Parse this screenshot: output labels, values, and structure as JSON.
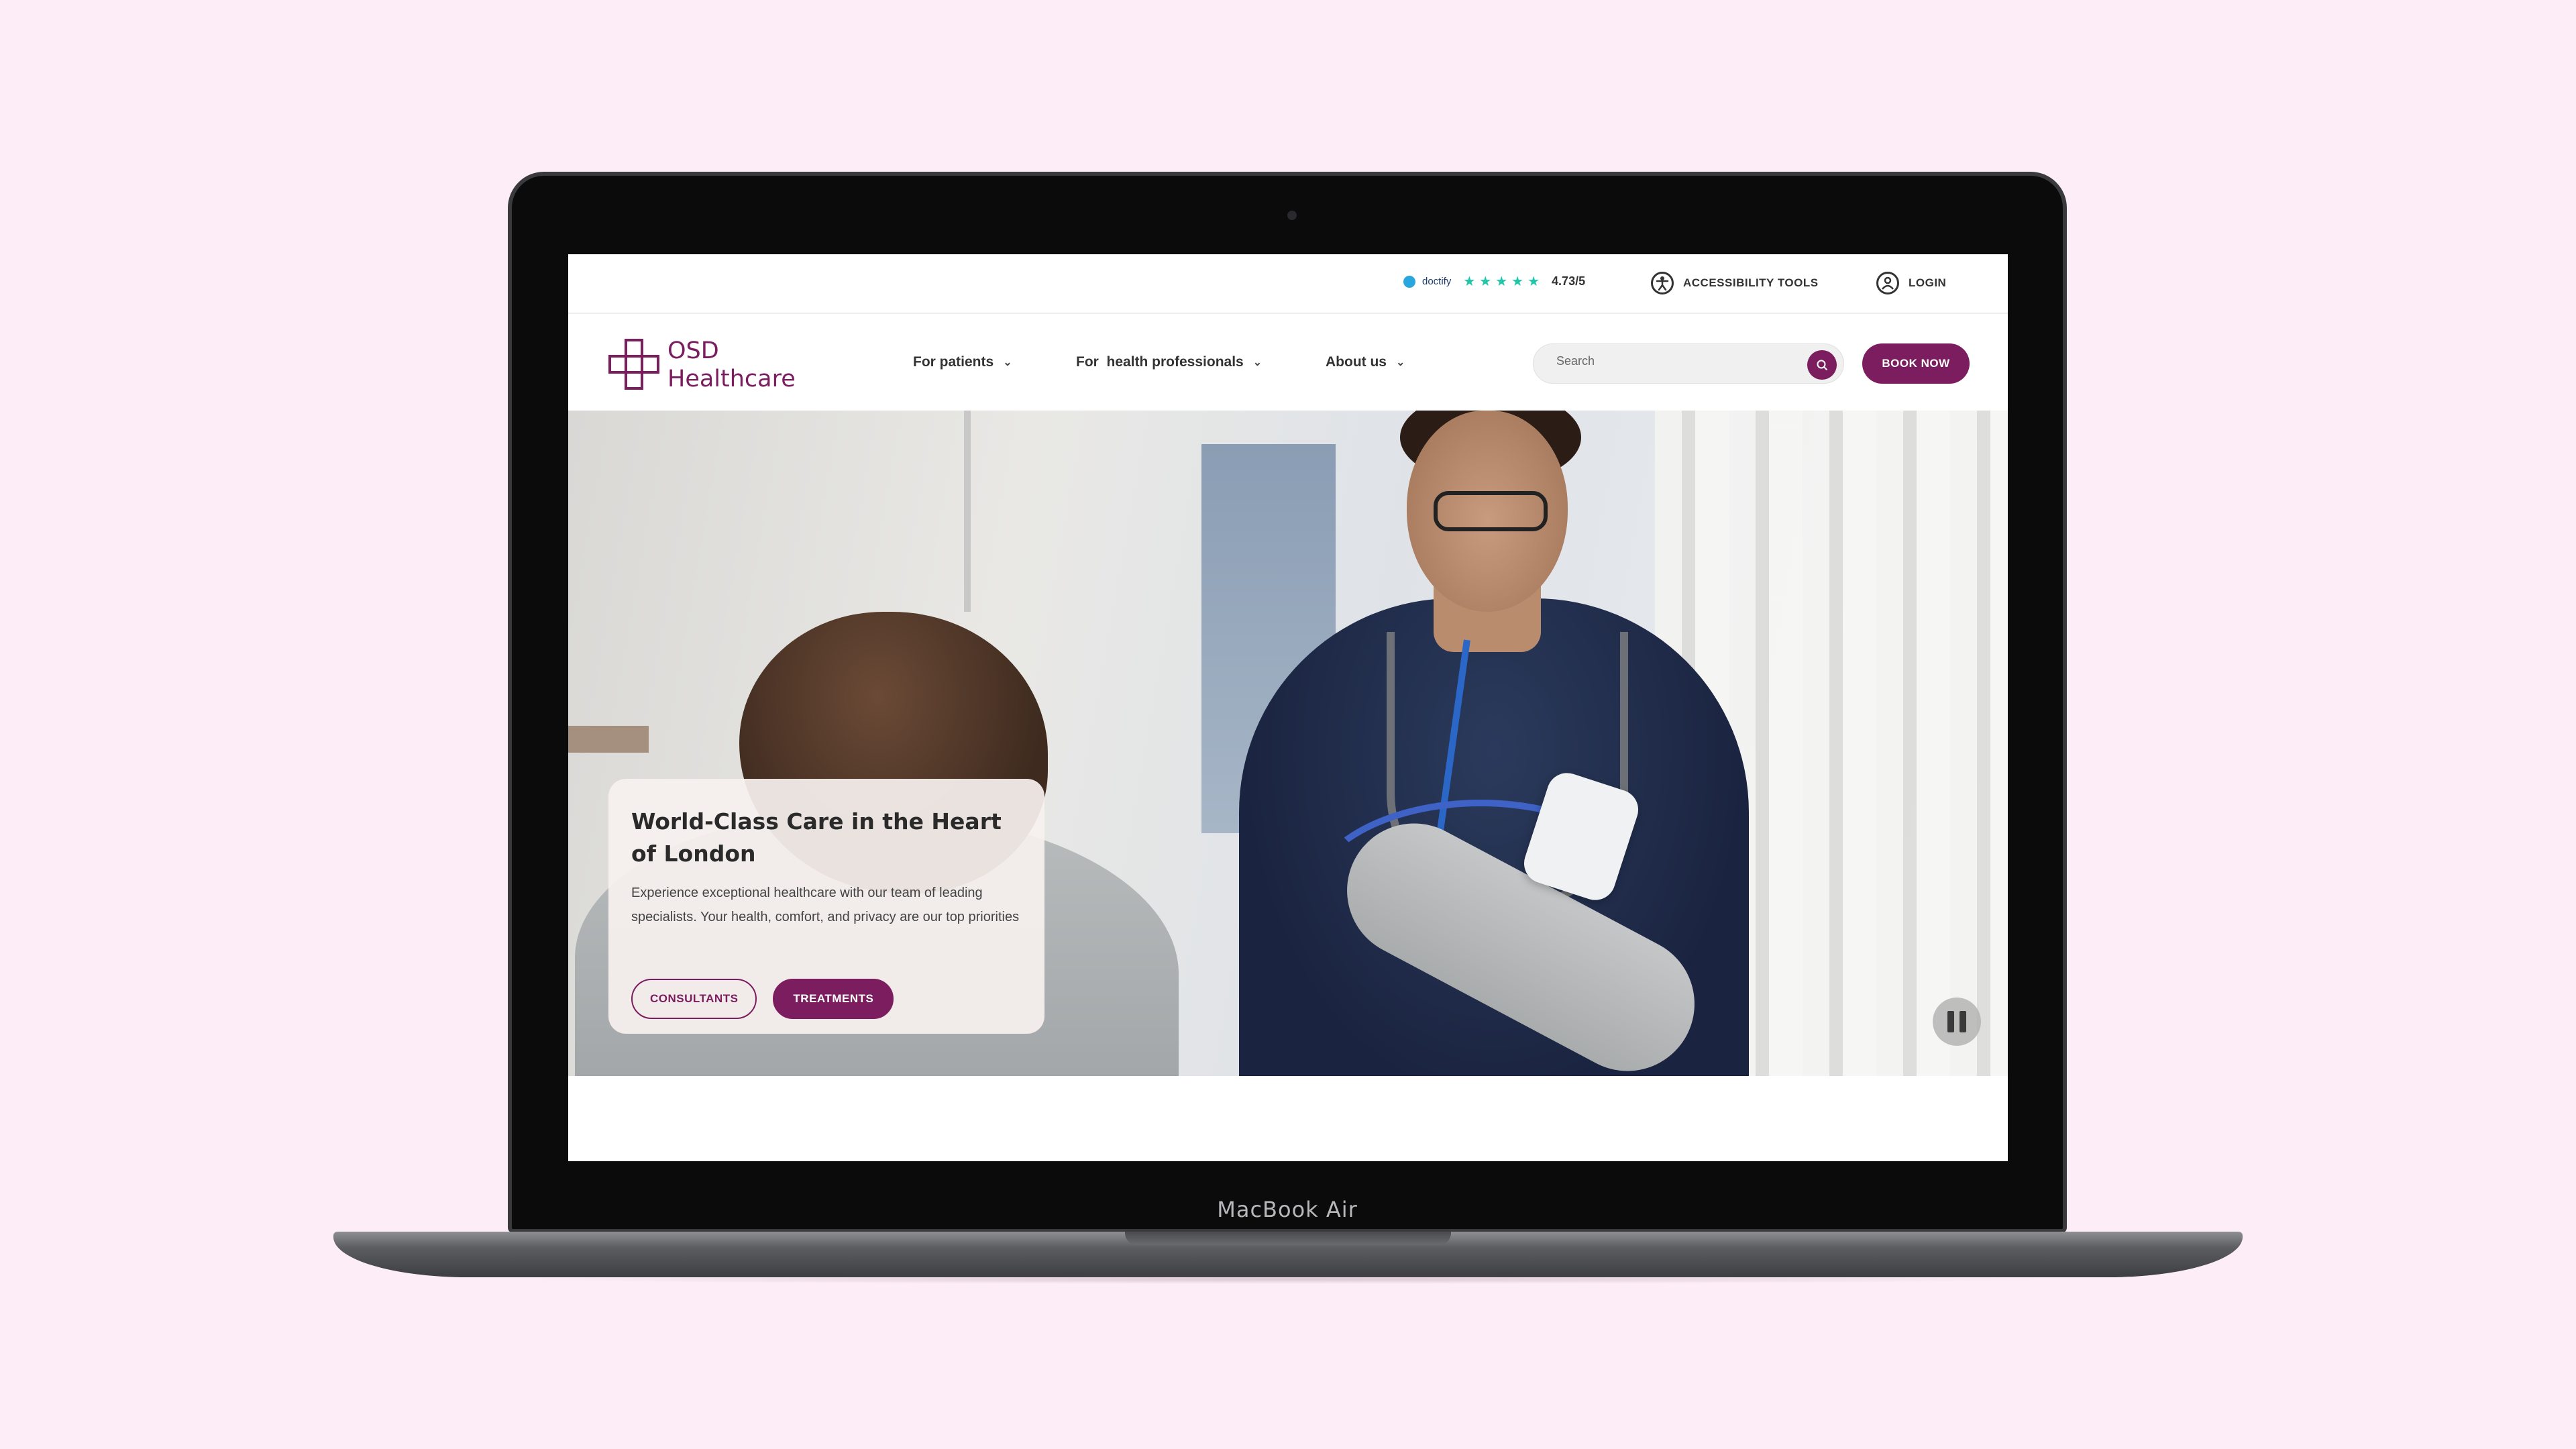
{
  "device": {
    "label": "MacBook Air"
  },
  "topbar": {
    "doctify_label": "doctify",
    "stars": [
      "★",
      "★",
      "★",
      "★",
      "★"
    ],
    "rating": "4.73/5",
    "accessibility_label": "ACCESSIBILITY TOOLS",
    "login_label": "LOGIN"
  },
  "brand": {
    "line1": "OSD",
    "line2": "Healthcare",
    "color": "#7b1d5e"
  },
  "nav": {
    "items": [
      {
        "label": "For patients"
      },
      {
        "label": "For  health professionals"
      },
      {
        "label": "About us"
      }
    ]
  },
  "search": {
    "placeholder": "Search"
  },
  "book_now_label": "BOOK NOW",
  "hero": {
    "title": "World-Class Care in the Heart of London",
    "text": "Experience exceptional healthcare with our team of leading specialists. Your health, comfort, and privacy are our top priorities",
    "consultants_label": "CONSULTANTS",
    "treatments_label": "TREATMENTS"
  },
  "colors": {
    "accent": "#7b1d5e",
    "stars": "#1ec6a9",
    "page_background": "#fcedf6"
  }
}
